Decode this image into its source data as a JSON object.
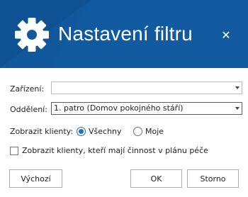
{
  "header": {
    "title": "Nastavení filtru",
    "close_symbol": "✕",
    "icon": "gear-icon",
    "color": "#10579b"
  },
  "form": {
    "device_label": "Zařízení:",
    "device_value": "",
    "department_label": "Oddělení:",
    "department_value": "1. patro (Domov pokojného stáří)",
    "show_clients_label": "Zobrazit klienty:",
    "show_clients_options": [
      {
        "label": "Všechny",
        "selected": true
      },
      {
        "label": "Moje",
        "selected": false
      }
    ],
    "activity_checkbox_label": "Zobrazit klienty, kteří mají činnost v plánu péče",
    "activity_checkbox_checked": false
  },
  "buttons": {
    "default_label": "Výchozí",
    "ok_label": "OK",
    "cancel_label": "Storno"
  },
  "colors": {
    "accent": "#1f6fc2"
  }
}
